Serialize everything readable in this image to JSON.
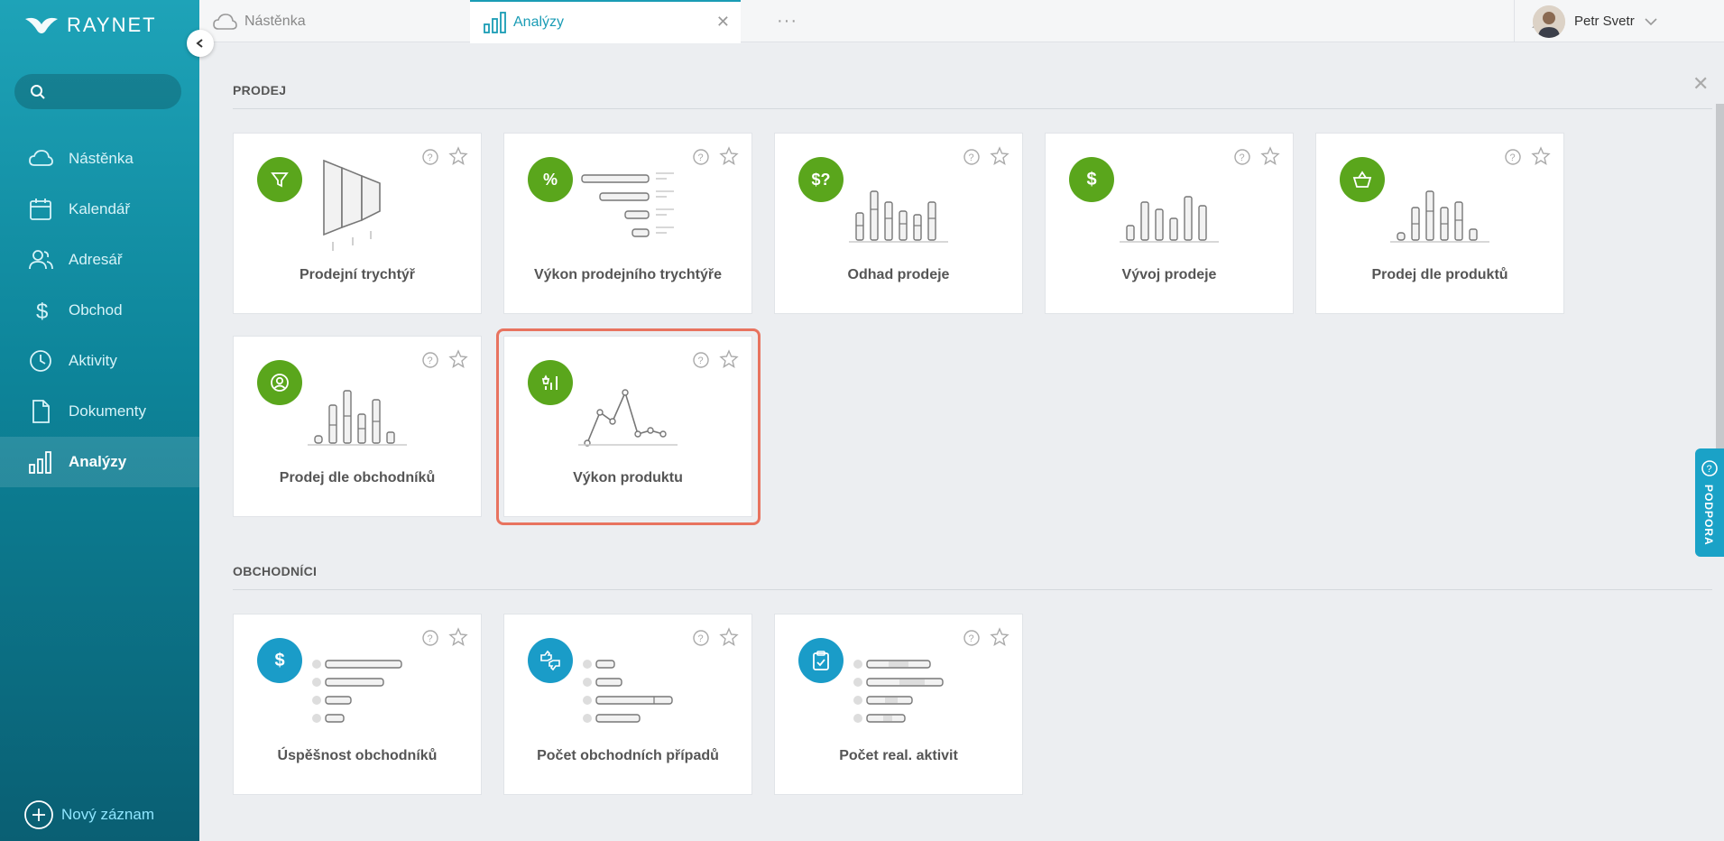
{
  "brand": {
    "name": "RAYNET"
  },
  "search": {
    "placeholder": ""
  },
  "sidebar": {
    "items": [
      {
        "label": "Nástěnka",
        "icon": "cloud-icon"
      },
      {
        "label": "Kalendář",
        "icon": "calendar-icon"
      },
      {
        "label": "Adresář",
        "icon": "contacts-icon"
      },
      {
        "label": "Obchod",
        "icon": "dollar-icon"
      },
      {
        "label": "Aktivity",
        "icon": "clock-icon"
      },
      {
        "label": "Dokumenty",
        "icon": "document-icon"
      },
      {
        "label": "Analýzy",
        "icon": "bar-chart-icon",
        "active": true
      }
    ],
    "new_record": "Nový záznam"
  },
  "tabs": [
    {
      "label": "Nástěnka",
      "icon": "cloud-icon"
    },
    {
      "label": "Analýzy",
      "icon": "bar-chart-icon",
      "active": true
    }
  ],
  "tab_more": "···",
  "user": {
    "name": "Petr Svetr"
  },
  "sections": {
    "sales": {
      "title": "PRODEJ",
      "cards": [
        {
          "label": "Prodejní trychtýř",
          "icon": "funnel-icon"
        },
        {
          "label": "Výkon prodejního trychtýře",
          "icon": "percent-icon"
        },
        {
          "label": "Odhad prodeje",
          "icon": "dollar-question-icon"
        },
        {
          "label": "Vývoj prodeje",
          "icon": "dollar-icon"
        },
        {
          "label": "Prodej dle produktů",
          "icon": "basket-icon"
        },
        {
          "label": "Prodej dle obchodníků",
          "icon": "user-circle-icon"
        },
        {
          "label": "Výkon produktu",
          "icon": "product-chart-icon",
          "highlighted": true
        }
      ]
    },
    "salespeople": {
      "title": "OBCHODNÍCI",
      "cards": [
        {
          "label": "Úspěšnost obchodníků",
          "icon": "dollar-icon"
        },
        {
          "label": "Počet obchodních případů",
          "icon": "deal-thumbs-icon"
        },
        {
          "label": "Počet real. aktivit",
          "icon": "clipboard-check-icon"
        }
      ]
    }
  },
  "support": {
    "label": "PODPORA"
  },
  "colors": {
    "accent": "#1a9cb5",
    "green_badge": "#5aa61c",
    "blue_badge": "#1a9cc8",
    "highlight": "#e8735f"
  }
}
